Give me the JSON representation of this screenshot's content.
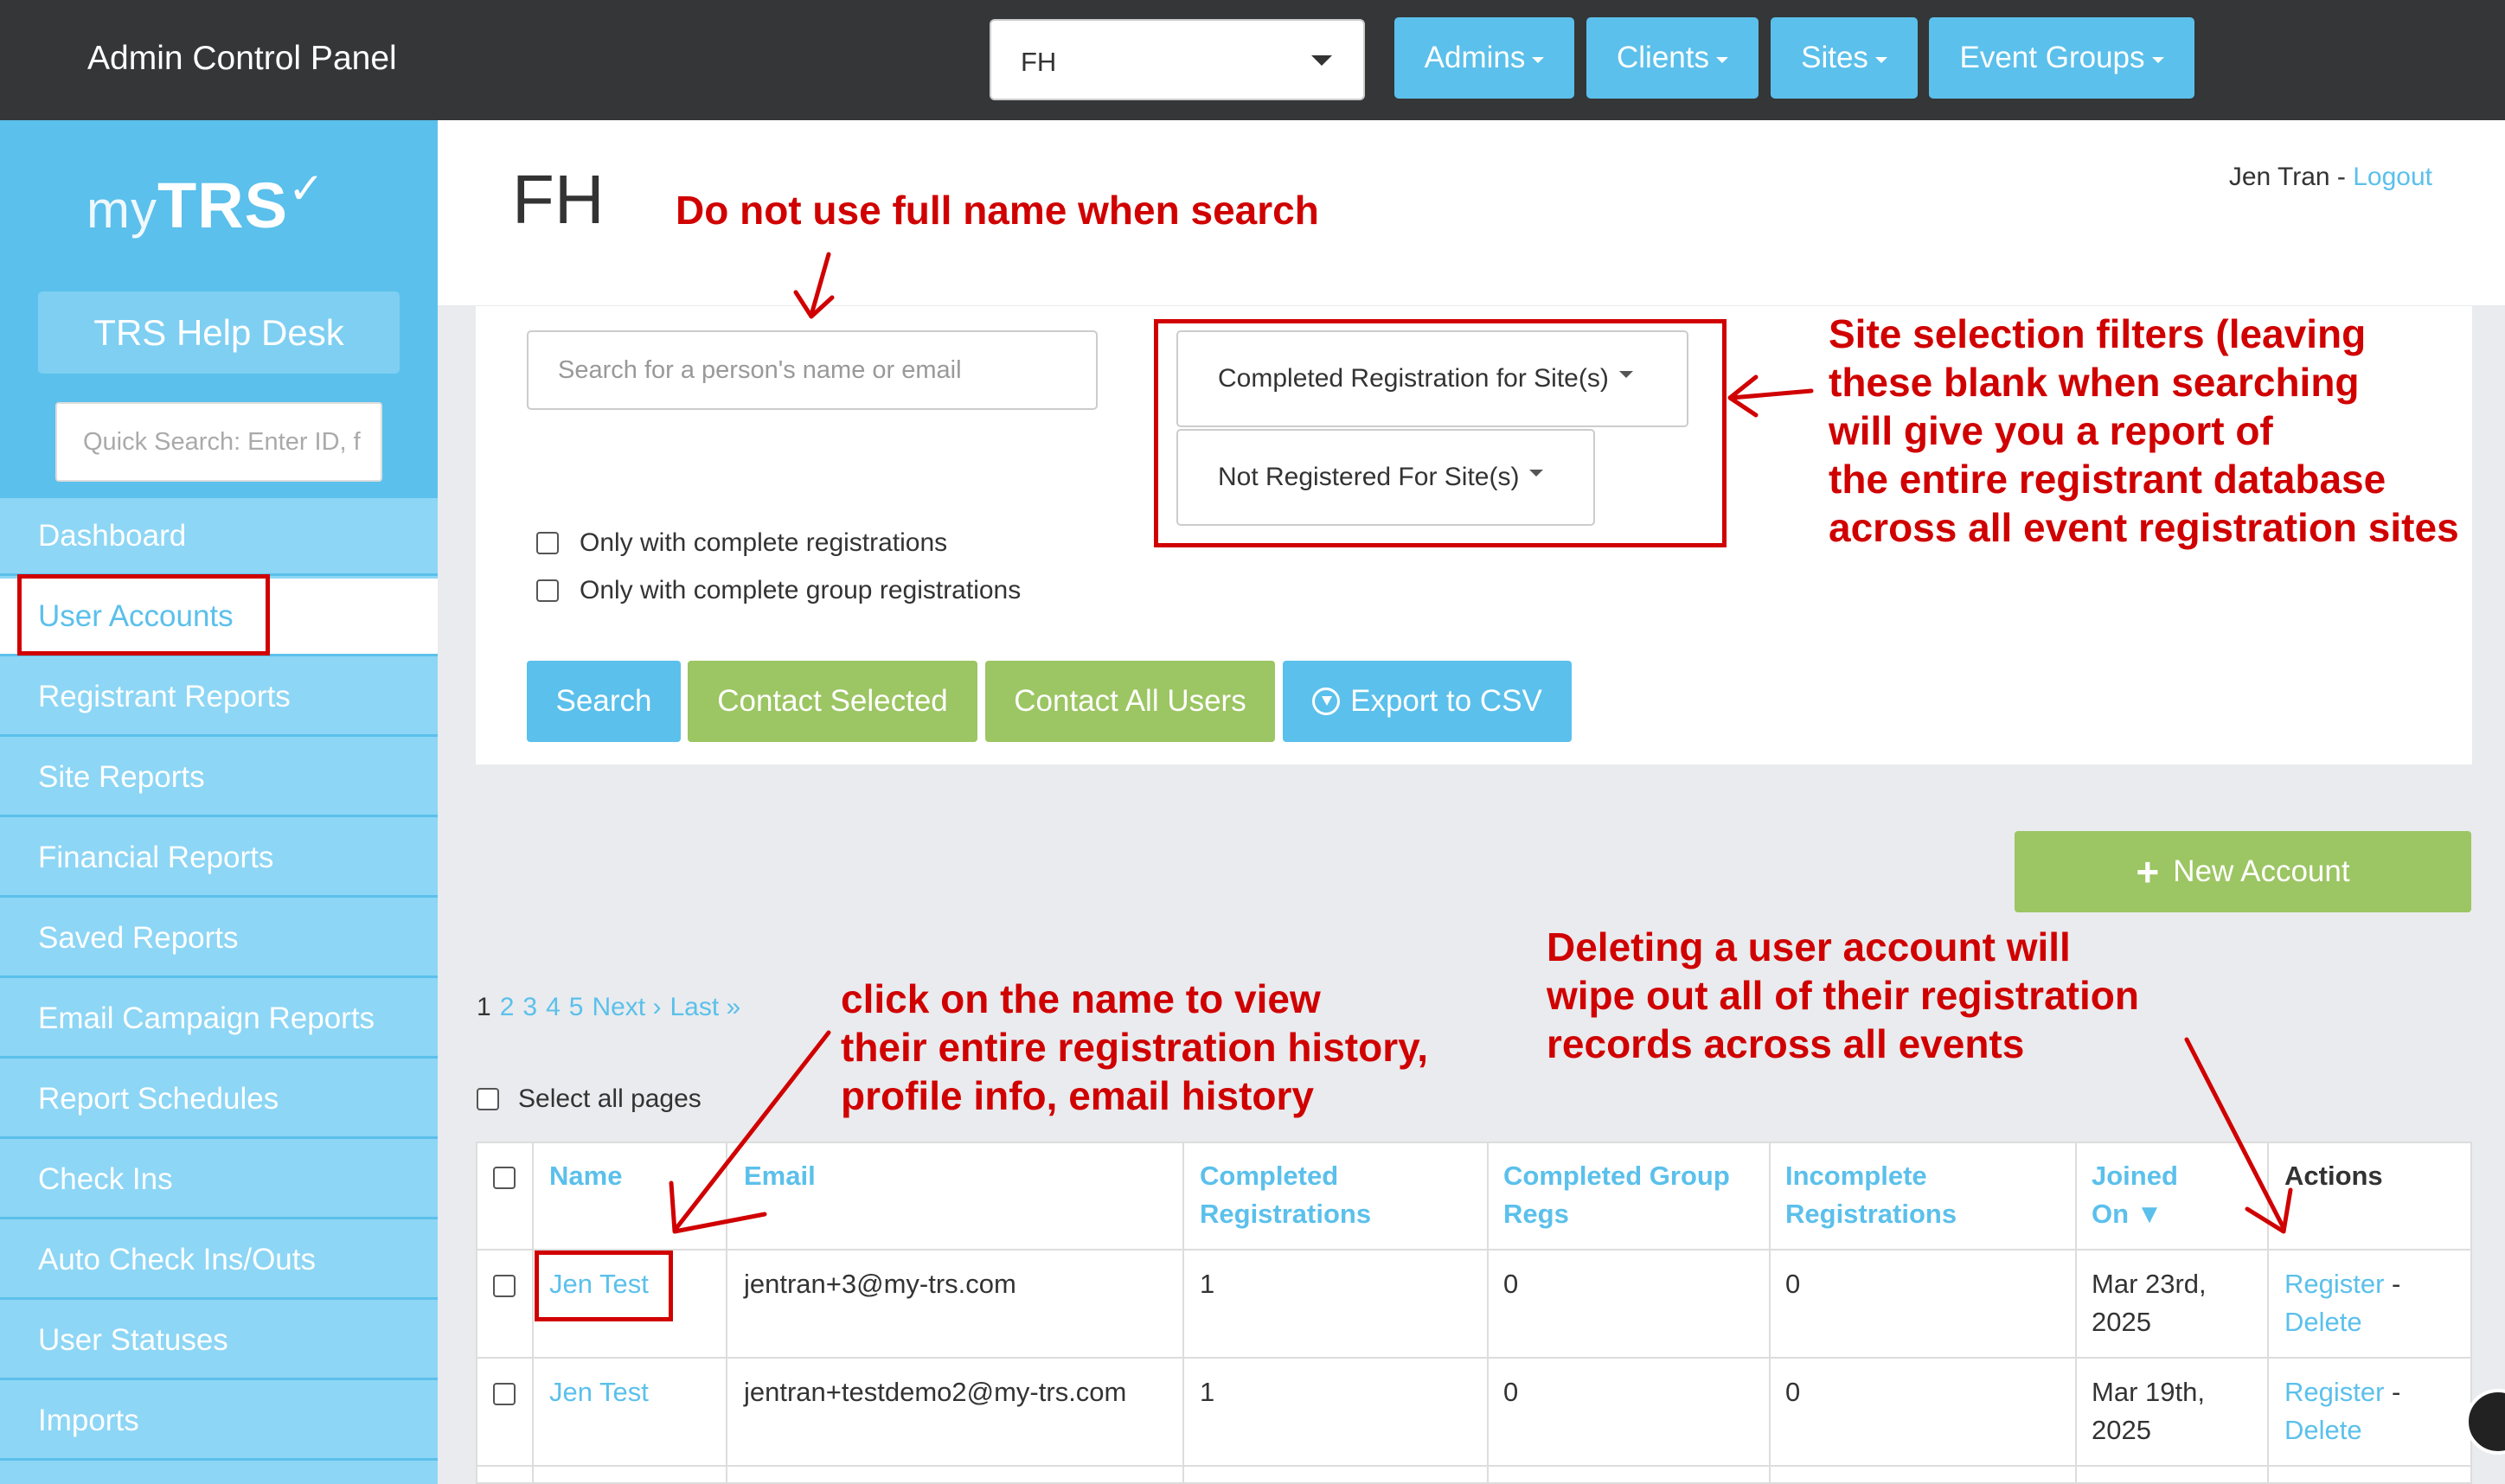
{
  "topbar": {
    "app_title": "Admin Control Panel",
    "client_select_value": "FH",
    "nav": [
      "Admins",
      "Clients",
      "Sites",
      "Event Groups"
    ]
  },
  "sidebar": {
    "logo_my": "my",
    "logo_trs": "TRS",
    "help_desk": "TRS Help Desk",
    "quick_search_placeholder": "Quick Search: Enter ID, f",
    "items": [
      "Dashboard",
      "User Accounts",
      "Registrant Reports",
      "Site Reports",
      "Financial Reports",
      "Saved Reports",
      "Email Campaign Reports",
      "Report Schedules",
      "Check Ins",
      "Auto Check Ins/Outs",
      "User Statuses",
      "Imports"
    ],
    "active_item": "User Accounts"
  },
  "header": {
    "page_title": "FH",
    "user_name": "Jen Tran",
    "separator": " - ",
    "logout": "Logout"
  },
  "filters": {
    "search_placeholder": "Search for a person's name or email",
    "completed_sites": "Completed Registration for Site(s)",
    "not_registered_sites": "Not Registered For Site(s)",
    "only_complete": "Only with complete registrations",
    "only_complete_group": "Only with complete group registrations"
  },
  "actions": {
    "search": "Search",
    "contact_selected": "Contact Selected",
    "contact_all": "Contact All Users",
    "export_csv": "Export to CSV",
    "new_account": "New Account"
  },
  "pagination": {
    "current": "1",
    "pages": [
      "2",
      "3",
      "4",
      "5"
    ],
    "next": "Next ›",
    "last": "Last »"
  },
  "select_all_pages": "Select all pages",
  "table": {
    "headers": {
      "name": "Name",
      "email": "Email",
      "completed_1": "Completed",
      "completed_2": "Registrations",
      "group_1": "Completed Group",
      "group_2": "Regs",
      "incomplete_1": "Incomplete",
      "incomplete_2": "Registrations",
      "joined_1": "Joined",
      "joined_2": "On ▼",
      "actions": "Actions"
    },
    "rows": [
      {
        "name": "Jen Test",
        "email": "jentran+3@my-trs.com",
        "completed": "1",
        "group": "0",
        "incomplete": "0",
        "joined_1": "Mar 23rd,",
        "joined_2": "2025",
        "register": "Register",
        "dash": " -",
        "delete": "Delete"
      },
      {
        "name": "Jen Test",
        "email": "jentran+testdemo2@my-trs.com",
        "completed": "1",
        "group": "0",
        "incomplete": "0",
        "joined_1": "Mar 19th,",
        "joined_2": "2025",
        "register": "Register",
        "dash": " -",
        "delete": "Delete"
      }
    ]
  },
  "annotations": {
    "search_note": "Do not use full name when search",
    "site_filter_note": [
      "Site selection filters (leaving",
      "these blank when searching",
      "will give you a report of",
      "the entire registrant database",
      "across all event registration sites"
    ],
    "delete_note": [
      "Deleting a user account will",
      "wipe out all of their registration",
      "records across all events"
    ],
    "name_note": [
      "click on the name to view",
      "their entire registration history,",
      "profile info, email history"
    ],
    "color": "#d00000"
  },
  "colors": {
    "topbar": "#343638",
    "primary": "#5bc0eb",
    "sidebar": "#8dd6f5",
    "success": "#9cc563"
  }
}
